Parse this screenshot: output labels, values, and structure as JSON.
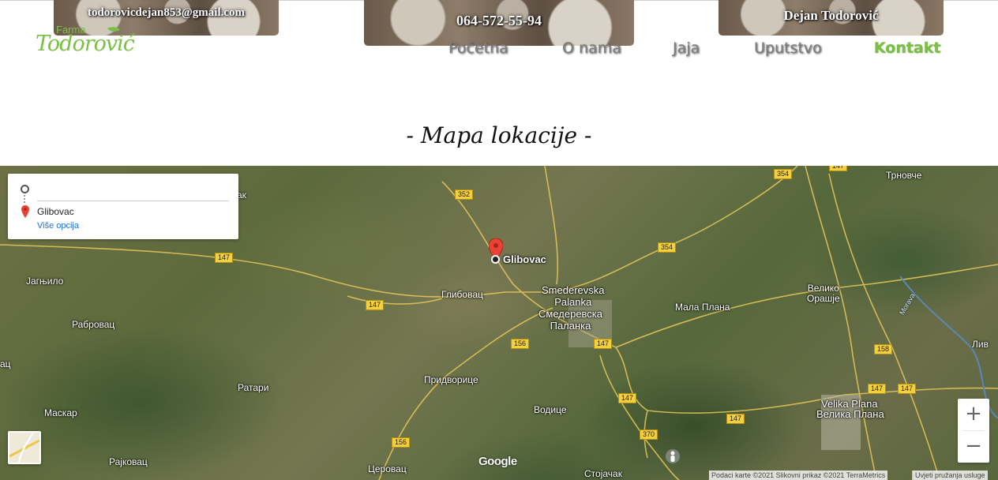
{
  "header": {
    "email": "todorovicdejan853@gmail.com",
    "phone": "064-572-55-94",
    "owner": "Dejan Todorović",
    "logo": {
      "farma": "Farma",
      "name": "Todorović"
    }
  },
  "nav": {
    "items": [
      {
        "label": "Početna",
        "active": false
      },
      {
        "label": "O nama",
        "active": false
      },
      {
        "label": "Jaja",
        "active": false
      },
      {
        "label": "Uputstvo",
        "active": false
      },
      {
        "label": "Kontakt",
        "active": true
      }
    ]
  },
  "section": {
    "title": "- Mapa lokacije -"
  },
  "map": {
    "directions": {
      "origin": "",
      "destination": "Glibovac",
      "more_options": "Više opcija"
    },
    "marker_label": "Glibovac",
    "places": {
      "trnovce": "Трновче",
      "jagnjilo": "Јагњило",
      "rabrovac": "Рабровац",
      "glibovac": "Глибовац",
      "smederevska_latin": "Smederevska\nPalanka",
      "smederevska_cyr": "Смедеревска\nПаланка",
      "mala_plana": "Мала Плана",
      "veliko_orasje": "Велико\nОрашје",
      "ratari": "Ратари",
      "pridvorice": "Придворице",
      "maskar": "Маскар",
      "vodice": "Водице",
      "velika_plana_latin": "Velika Plana",
      "velika_plana_cyr": "Велика Плана",
      "rajkovac": "Рајковац",
      "cerovac": "Церовац",
      "stojacak": "Стојачак",
      "edge_ak": "ак",
      "edge_ac": "ац",
      "edge_liva": "Лив",
      "edge_di": "Дл"
    },
    "river": "Morava",
    "shields": [
      "352",
      "354",
      "147",
      "147",
      "354",
      "147",
      "156",
      "147",
      "158",
      "147",
      "147",
      "147",
      "147",
      "370",
      "156"
    ],
    "zoom_in": "+",
    "zoom_out": "−",
    "google": "Google",
    "attribution": "Podaci karte ©2021 Slikovni prikaz ©2021 TerraMetrics",
    "terms": "Uvjeti pružanja usluge"
  }
}
